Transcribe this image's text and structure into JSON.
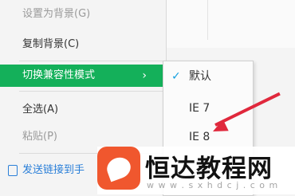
{
  "context_menu": {
    "items": [
      {
        "label": "设置为背景(G)",
        "disabled": true
      },
      {
        "label": "复制背景(C)",
        "disabled": false
      },
      {
        "label": "切换兼容性模式",
        "active": true,
        "chevron": "›"
      },
      {
        "label": "全选(A)",
        "disabled": false
      },
      {
        "label": "粘贴(P)",
        "disabled": true
      },
      {
        "label": "发送链接到手",
        "icon": "phone-link-icon"
      }
    ]
  },
  "submenu": {
    "items": [
      {
        "label": "默认",
        "checked": true,
        "check_glyph": "✓"
      },
      {
        "label": "IE 7"
      },
      {
        "label": "IE 8"
      }
    ]
  },
  "watermark": {
    "title": "恒达教程网",
    "url": "w w w . s x h d c j . c o m"
  },
  "colors": {
    "highlight": "#14b05a",
    "arrow": "#e0283c",
    "logo": "#f0572e"
  }
}
